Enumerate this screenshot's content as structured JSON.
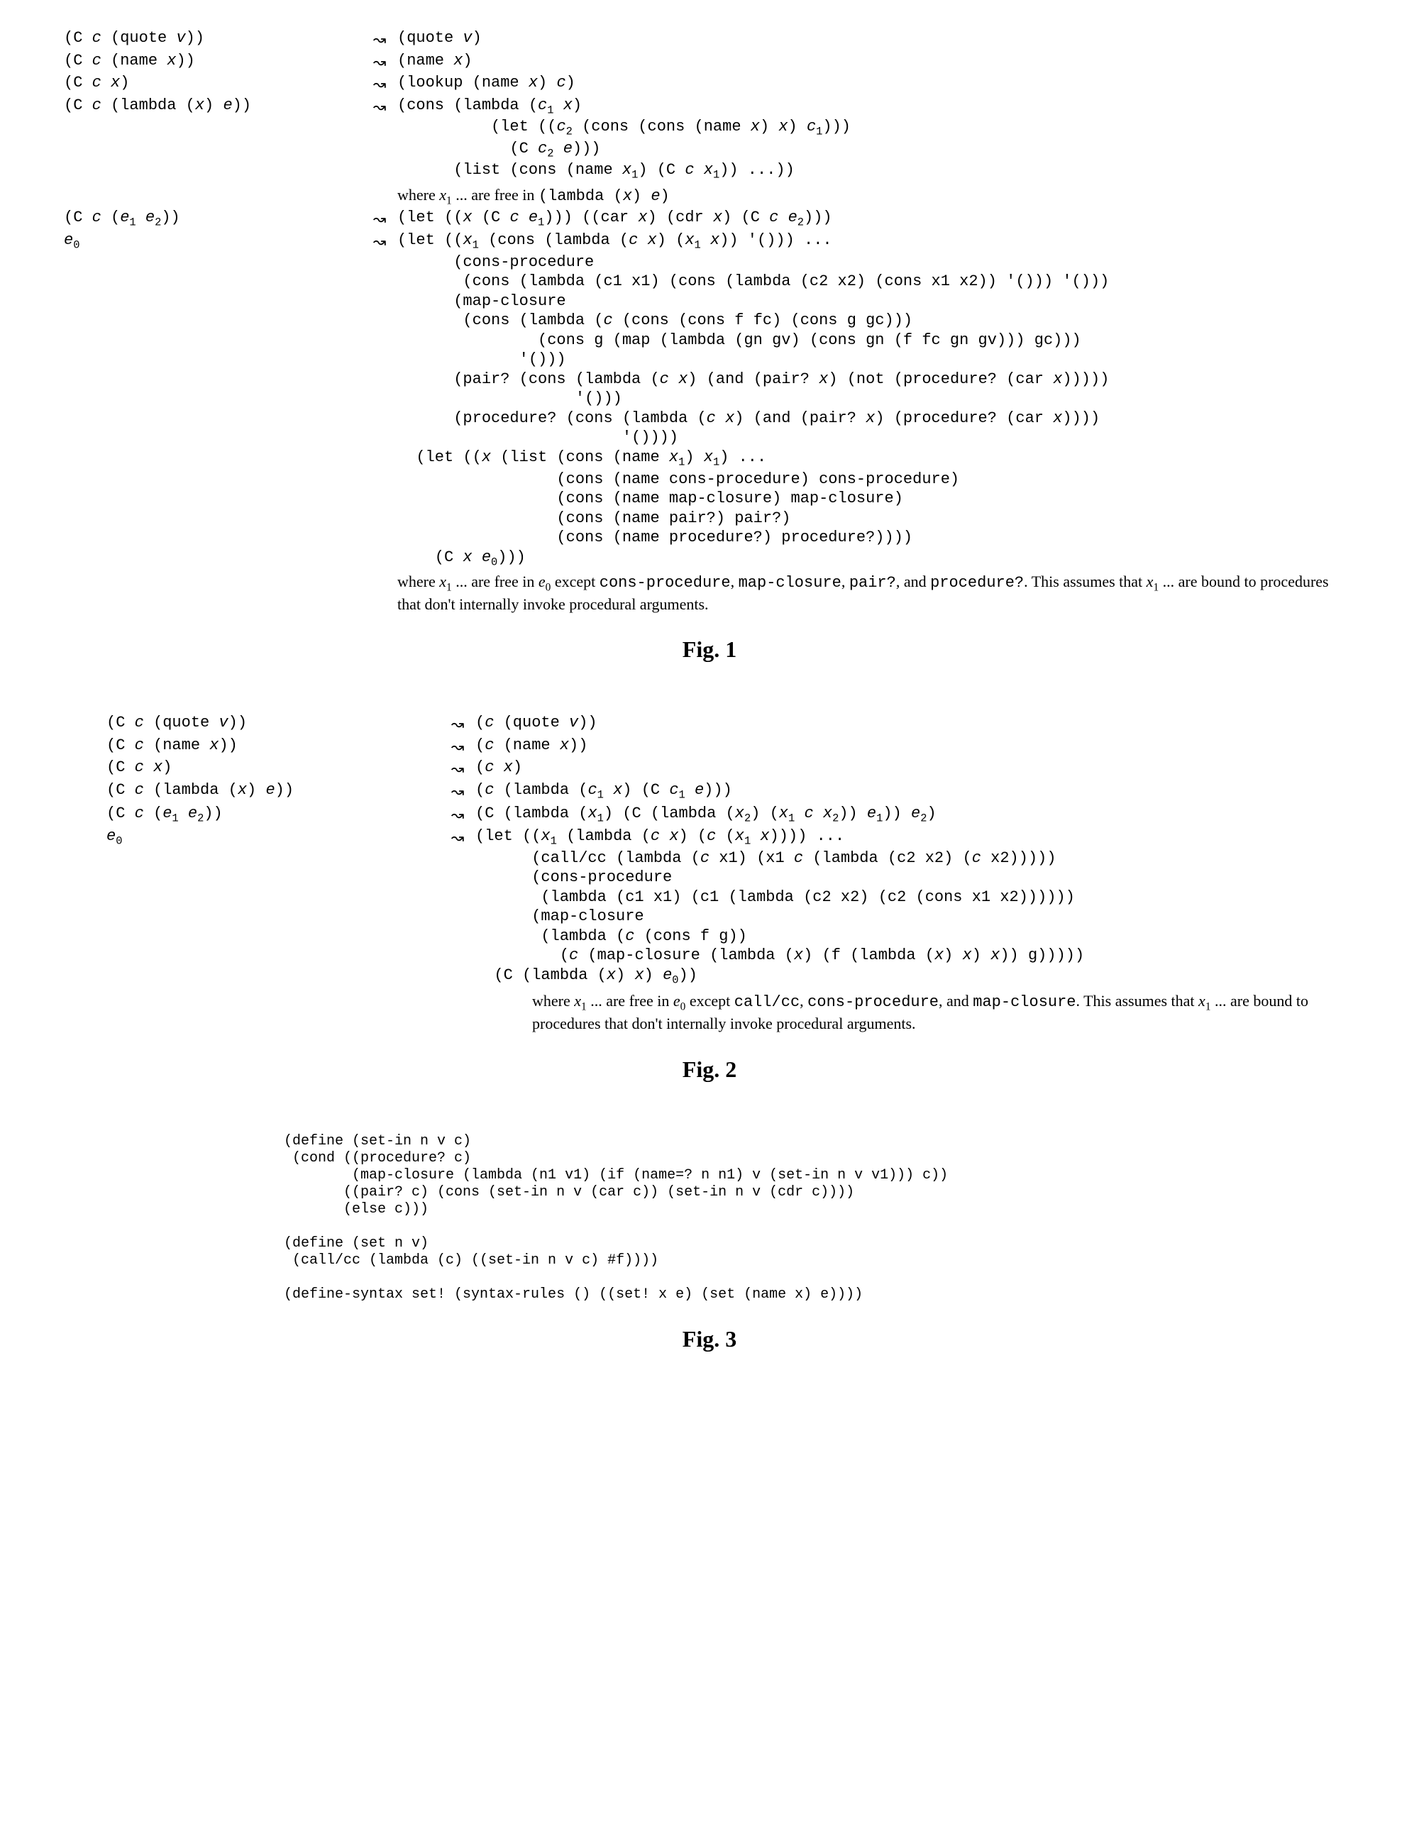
{
  "fig1": {
    "rows": [
      {
        "left": "(C c (quote v))",
        "right": "(quote v)"
      },
      {
        "left": "(C c (name x))",
        "right": "(name x)"
      },
      {
        "left": "(C c x)",
        "right": "(lookup (name x) c)"
      },
      {
        "left": "(C c (lambda (x) e))",
        "right": "(cons (lambda (c₁ x)\n          (let ((c₂ (cons (cons (name x) x) c₁)))\n            (C c₂ e)))\n      (list (cons (name x₁) (C c x₁)) ...))"
      },
      {
        "note": "where x₁ ... are free in (lambda (x) e)",
        "noteClass": "note"
      },
      {
        "left": "(C c (e₁ e₂))",
        "right": "(let ((x (C c e₁))) ((car x) (cdr x) (C c e₂)))"
      },
      {
        "left": "e₀",
        "right": "(let ((x₁ (cons (lambda (c x) (x₁ x)) '())) ...\n      (cons-procedure\n       (cons (lambda (c1 x1) (cons (lambda (c2 x2) (cons x1 x2)) '())) '()))\n      (map-closure\n       (cons (lambda (c (cons (cons f fc) (cons g gc)))\n               (cons g (map (lambda (gn gv) (cons gn (f fc gn gv))) gc)))\n             '()))\n      (pair? (cons (lambda (c x) (and (pair? x) (not (procedure? (car x)))))\n                   '()))\n      (procedure? (cons (lambda (c x) (and (pair? x) (procedure? (car x))))\n                        '())))\n  (let ((x (list (cons (name x₁) x₁) ...\n                 (cons (name cons-procedure) cons-procedure)\n                 (cons (name map-closure) map-closure)\n                 (cons (name pair?) pair?)\n                 (cons (name procedure?) procedure?))))\n    (C x e₀)))"
      },
      {
        "note": "where x₁ ... are free in e₀ except cons-procedure, map-closure, pair?, and procedure?. This assumes that x₁ ... are bound to procedures that don't internally invoke procedural arguments.",
        "noteClass": "note"
      }
    ],
    "label": "Fig. 1"
  },
  "fig2": {
    "rows": [
      {
        "left": "(C c (quote v))",
        "right": "(c (quote v))"
      },
      {
        "left": "(C c (name x))",
        "right": "(c (name x))"
      },
      {
        "left": "(C c x)",
        "right": "(c x)"
      },
      {
        "left": "(C c (lambda (x) e))",
        "right": "(c (lambda (c₁ x) (C c₁ e)))"
      },
      {
        "left": "(C c (e₁ e₂))",
        "right": "(C (lambda (x₁) (C (lambda (x₂) (x₁ c x₂)) e₁)) e₂)"
      },
      {
        "left": "e₀",
        "right": "(let ((x₁ (lambda (c x) (c (x₁ x)))) ...\n      (call/cc (lambda (c x1) (x1 c (lambda (c2 x2) (c x2)))))\n      (cons-procedure\n       (lambda (c1 x1) (c1 (lambda (c2 x2) (c2 (cons x1 x2))))))\n      (map-closure\n       (lambda (c (cons f g))\n         (c (map-closure (lambda (x) (f (lambda (x) x) x)) g)))))\n  (C (lambda (x) x) e₀))"
      },
      {
        "note": "where x₁ ... are free in e₀ except call/cc, cons-procedure, and map-closure. This assumes that x₁ ... are bound to procedures that don't internally invoke procedural arguments.",
        "noteClass": "note-indent"
      }
    ],
    "label": "Fig. 2"
  },
  "fig3": {
    "code": "(define (set-in n v c)\n (cond ((procedure? c)\n        (map-closure (lambda (n1 v1) (if (name=? n n1) v (set-in n v v1))) c))\n       ((pair? c) (cons (set-in n v (car c)) (set-in n v (cdr c))))\n       (else c)))\n\n(define (set n v)\n (call/cc (lambda (c) ((set-in n v c) #f))))\n\n(define-syntax set! (syntax-rules () ((set! x e) (set (name x) e))))",
    "label": "Fig. 3"
  }
}
